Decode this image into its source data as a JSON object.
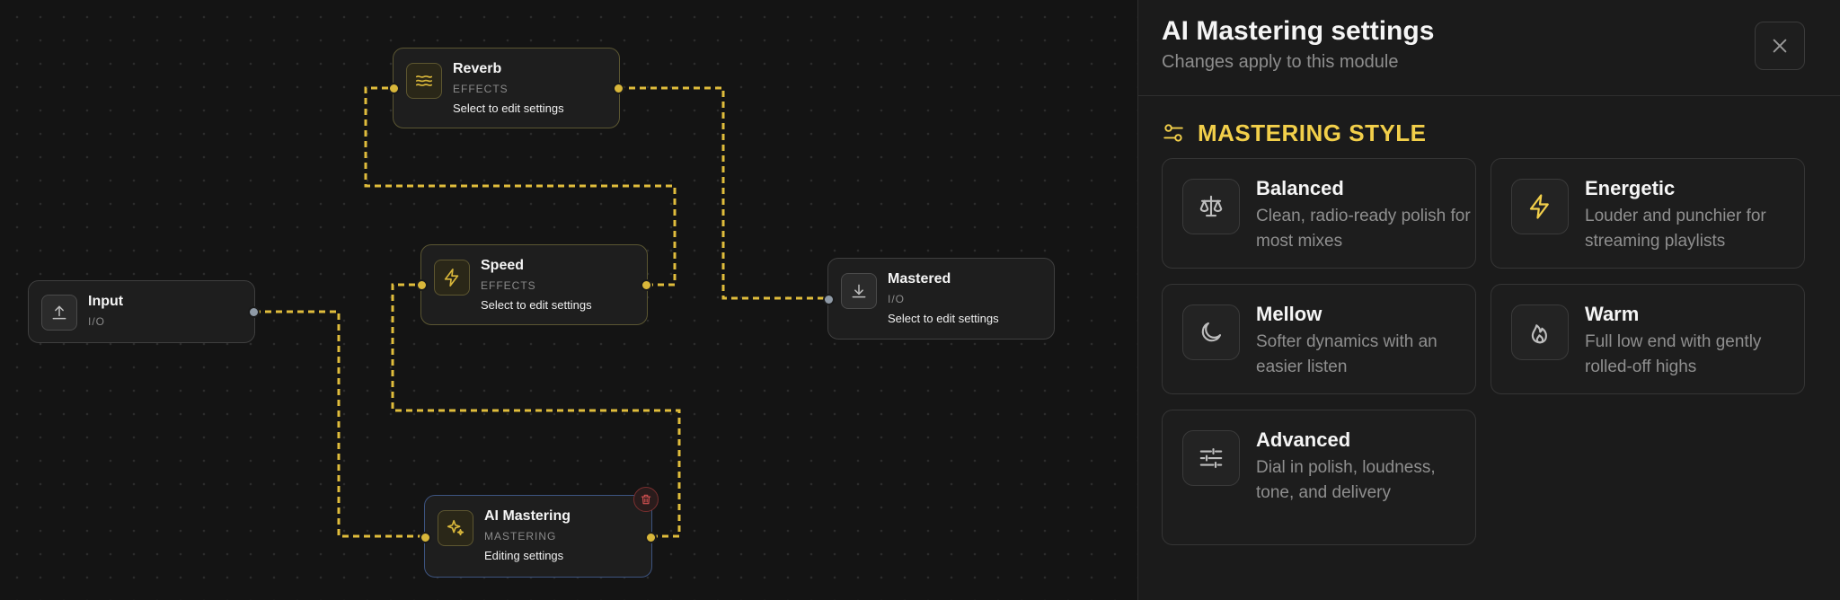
{
  "nodes": {
    "reverb": {
      "title": "Reverb",
      "category": "EFFECTS",
      "hint": "Select to edit settings",
      "icon": "waves-icon"
    },
    "speed": {
      "title": "Speed",
      "category": "EFFECTS",
      "hint": "Select to edit settings",
      "icon": "lightning-icon"
    },
    "input": {
      "title": "Input",
      "category": "I/O",
      "icon": "upload-icon"
    },
    "mastered": {
      "title": "Mastered",
      "category": "I/O",
      "hint": "Select to edit settings",
      "icon": "download-icon"
    },
    "ai_mastering": {
      "title": "AI Mastering",
      "category": "MASTERING",
      "hint": "Editing settings",
      "icon": "sparkle-icon",
      "delete_icon": "trash-icon"
    }
  },
  "panel": {
    "title": "AI Mastering settings",
    "subtitle": "Changes apply to this module",
    "close_icon": "close-icon",
    "section": {
      "title": "MASTERING STYLE",
      "icon": "sliders-toggle-icon"
    },
    "styles": [
      {
        "name": "Balanced",
        "description": "Clean, radio-ready polish for most mixes",
        "icon": "scale-icon"
      },
      {
        "name": "Energetic",
        "description": "Louder and punchier for streaming playlists",
        "icon": "lightning-icon"
      },
      {
        "name": "Mellow",
        "description": "Softer dynamics with an easier listen",
        "icon": "moon-icon"
      },
      {
        "name": "Warm",
        "description": "Full low end with gently rolled-off highs",
        "icon": "flame-icon"
      },
      {
        "name": "Advanced",
        "description": "Dial in polish, loudness, tone, and delivery",
        "icon": "sliders-icon"
      }
    ]
  },
  "colors": {
    "accent": "#f2cf4a",
    "wire": "#e0bd3c",
    "active_border": "#3d5480",
    "delete": "#d05050"
  }
}
